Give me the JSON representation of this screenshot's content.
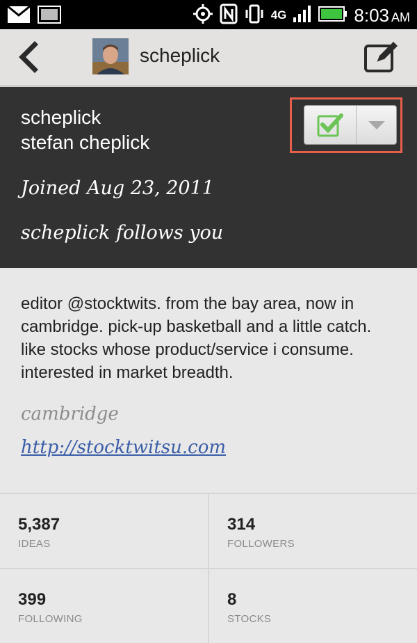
{
  "status_bar": {
    "time": "8:03",
    "ampm": "AM",
    "network": "4G",
    "icons": [
      "gmail-icon",
      "gallery-icon",
      "gps-icon",
      "nfc-icon",
      "vibrate-icon",
      "signal-icon",
      "battery-icon"
    ]
  },
  "action_bar": {
    "title": "scheplick",
    "back_icon": "back-chevron-icon",
    "compose_icon": "compose-icon"
  },
  "profile": {
    "username": "scheplick",
    "full_name": "stefan cheplick",
    "joined": "Joined Aug 23, 2011",
    "follows_you": "scheplick follows you",
    "follow_button": {
      "state": "following",
      "check_icon": "check-icon",
      "dropdown_icon": "triangle-down-icon"
    }
  },
  "bio": {
    "text": "editor @stocktwits. from the bay area, now in cambridge. pick-up basketball and a little catch. like stocks whose product/service i consume. interested in market breadth.",
    "location": "cambridge",
    "website": "http://stocktwitsu.com"
  },
  "stats": [
    {
      "value": "5,387",
      "label": "IDEAS"
    },
    {
      "value": "314",
      "label": "FOLLOWERS"
    },
    {
      "value": "399",
      "label": "FOLLOWING"
    },
    {
      "value": "8",
      "label": "STOCKS"
    }
  ],
  "colors": {
    "header_bg": "#333232",
    "highlight_frame": "#e8604c",
    "check_green": "#5cc04a",
    "link": "#3a5ea8"
  }
}
